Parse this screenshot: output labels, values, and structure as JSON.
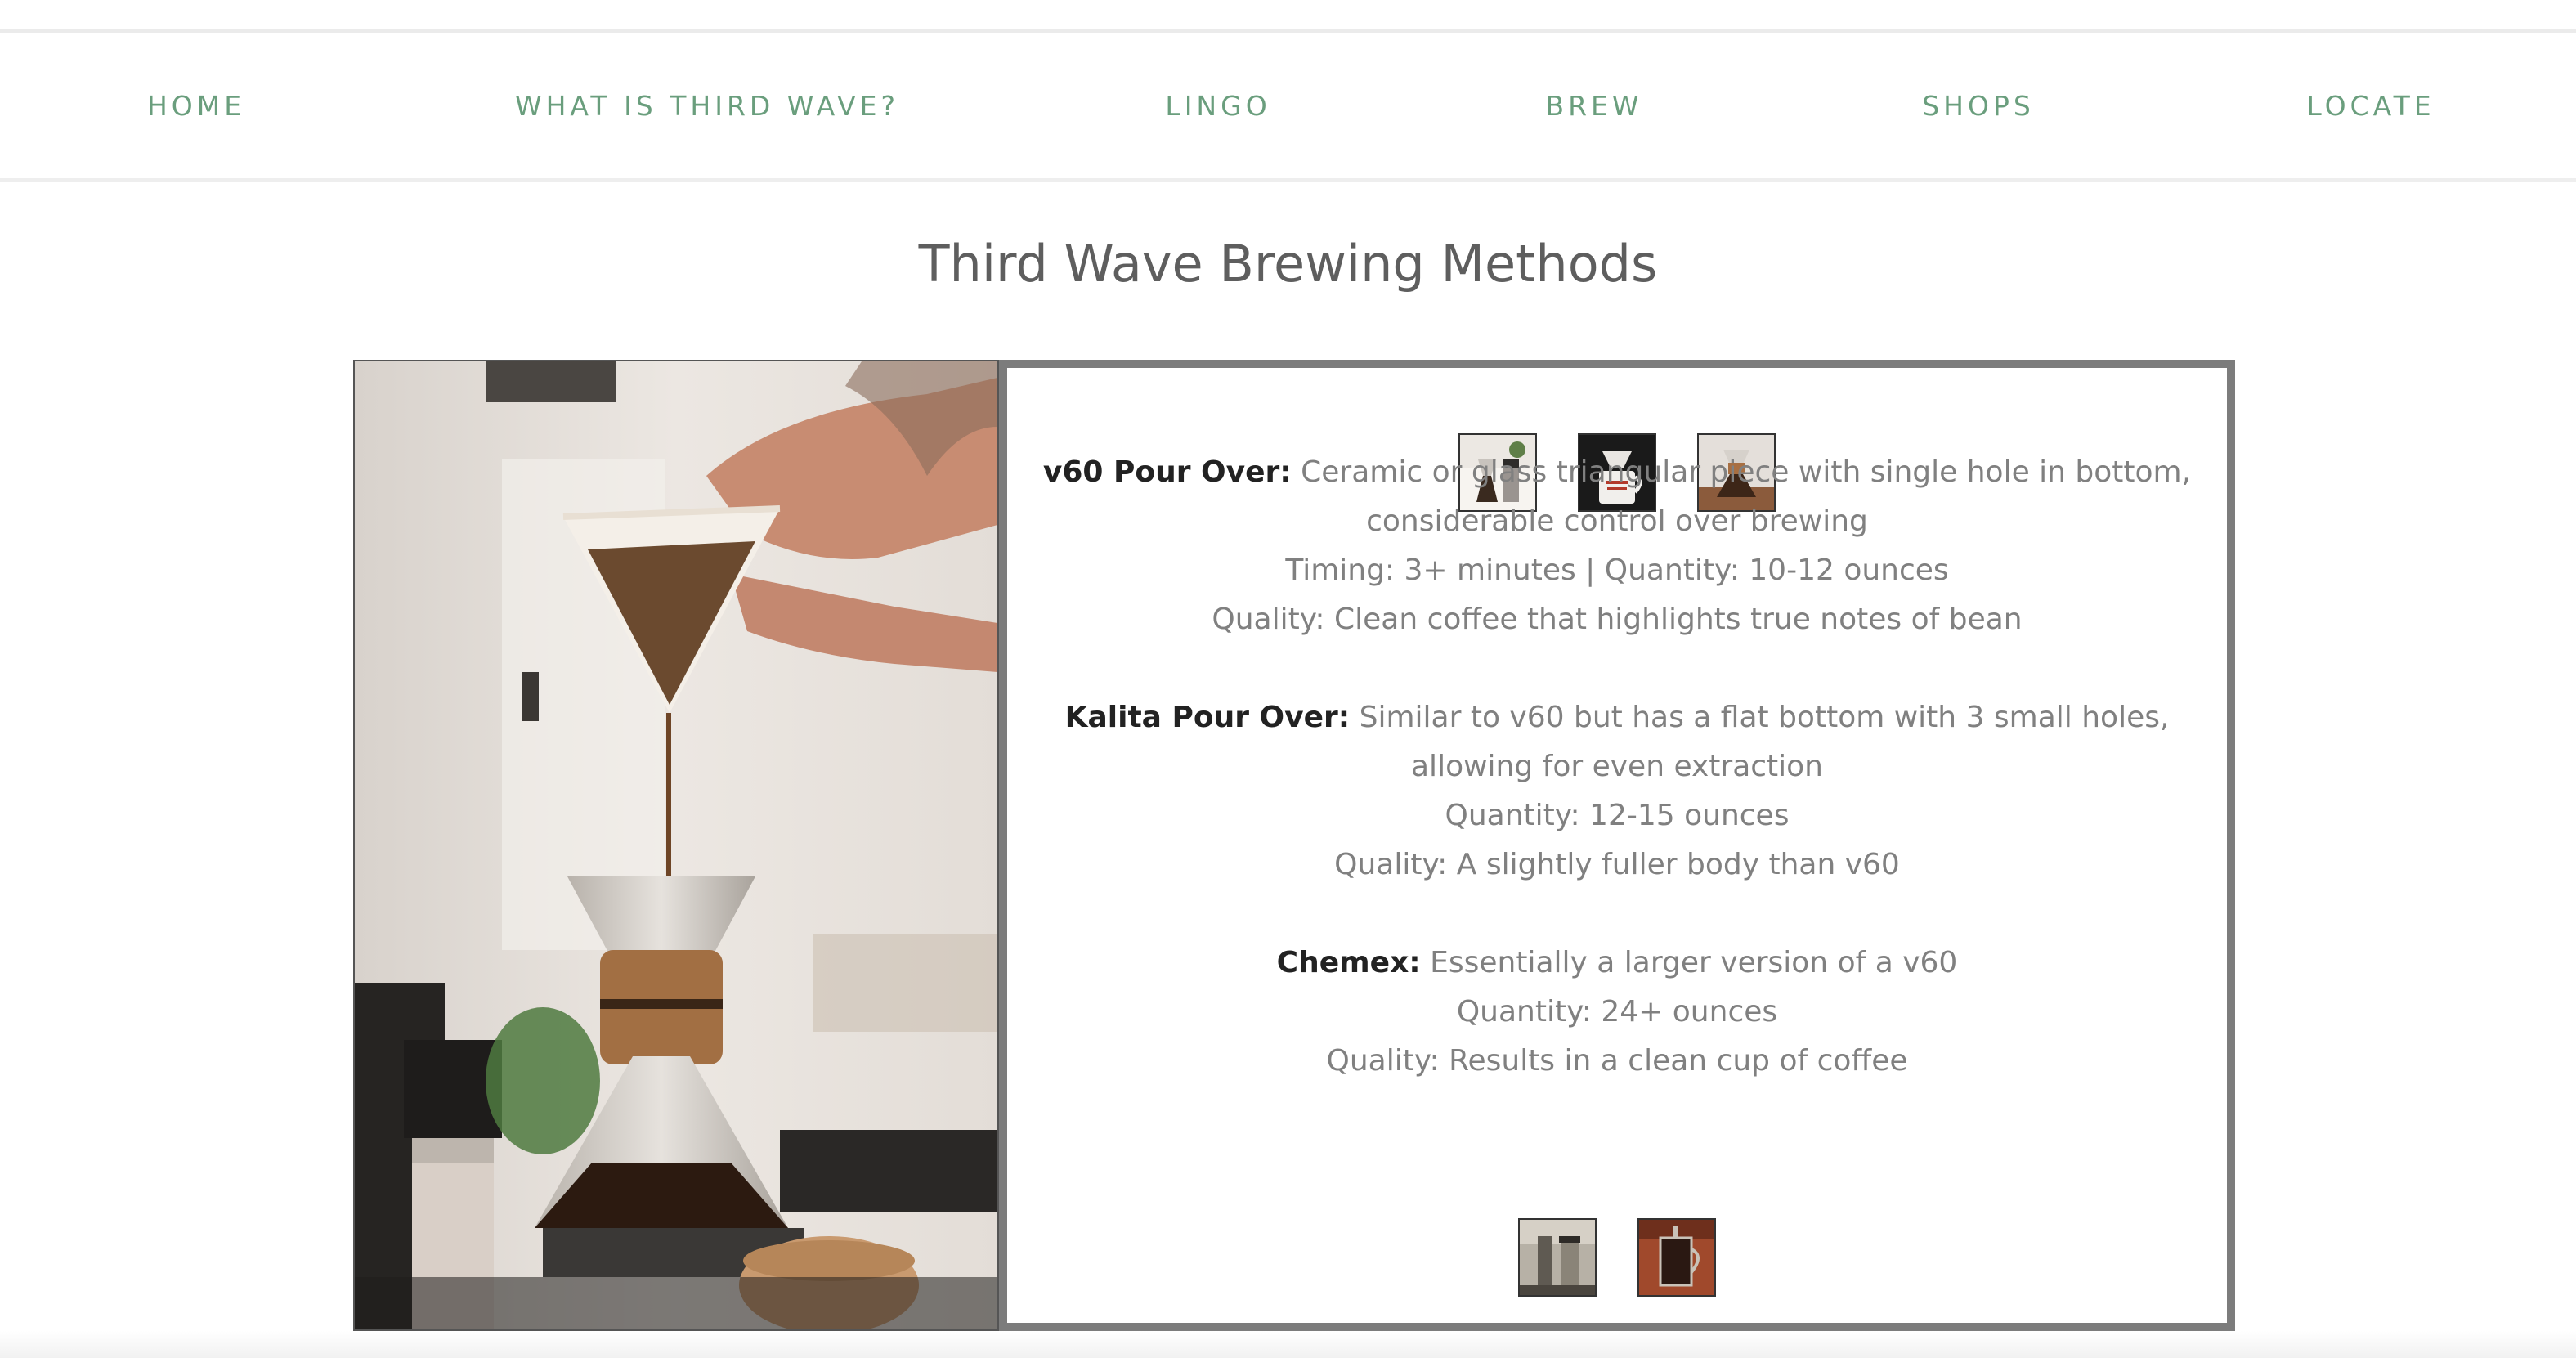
{
  "nav": {
    "items": [
      {
        "label": "HOME"
      },
      {
        "label": "WHAT IS THIRD WAVE?"
      },
      {
        "label": "LINGO"
      },
      {
        "label": "BREW"
      },
      {
        "label": "SHOPS"
      },
      {
        "label": "LOCATE"
      }
    ]
  },
  "page": {
    "title": "Third Wave Brewing Methods"
  },
  "methods": [
    {
      "name": "v60 Pour Over:",
      "description": "Ceramic or glass triangular piece with single hole in bottom, considerable control over brewing",
      "details": [
        "Timing: 3+ minutes | Quantity: 10-12 ounces",
        "Quality: Clean coffee that highlights true notes of bean"
      ]
    },
    {
      "name": "Kalita Pour Over:",
      "description": "Similar to v60 but has a flat bottom with 3 small holes, allowing for even extraction",
      "details": [
        "Quantity: 12-15 ounces",
        "Quality: A slightly fuller body than v60"
      ]
    },
    {
      "name": "Chemex:",
      "description": "Essentially a larger version of a v60",
      "details": [
        "Quantity: 24+ ounces",
        "Quality: Results in a clean cup of coffee"
      ]
    }
  ],
  "colors": {
    "nav_text": "#6a9e7d",
    "title_text": "#5e5e5e",
    "body_text": "#808080",
    "method_name": "#222222",
    "box_border": "#7c7c7c"
  },
  "images": {
    "hero": "hero-pour-over-photo",
    "top_thumbnails": [
      "chemex-thumbnail",
      "mug-pour-over-thumbnail",
      "chemex-wood-collar-thumbnail"
    ],
    "bottom_thumbnails": [
      "siphon-brewer-thumbnail",
      "french-press-thumbnail"
    ]
  }
}
